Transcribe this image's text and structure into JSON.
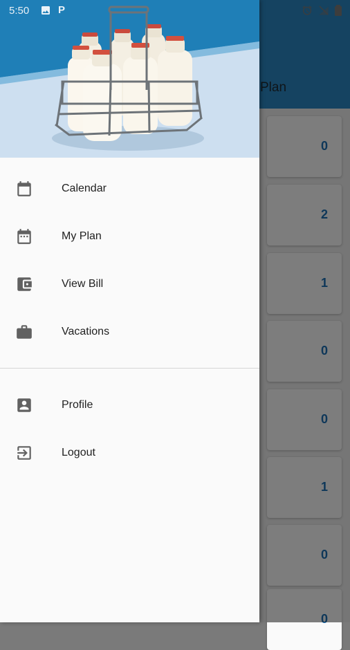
{
  "status_bar": {
    "time": "5:50",
    "left_icons": [
      "image-icon",
      "p-app-icon"
    ],
    "right_icons": [
      "alarm-icon",
      "wifi-off-icon",
      "signal-icon",
      "battery-icon"
    ]
  },
  "background_screen": {
    "title_fragment": "Plan",
    "counts": [
      "0",
      "2",
      "1",
      "0",
      "0",
      "1",
      "0",
      "0"
    ]
  },
  "drawer": {
    "header_image": "milk-bottles-in-crate",
    "items": [
      {
        "label": "Calendar",
        "icon": "calendar-icon"
      },
      {
        "label": "My Plan",
        "icon": "event-note-icon"
      },
      {
        "label": "View Bill",
        "icon": "wallet-icon"
      },
      {
        "label": "Vacations",
        "icon": "briefcase-icon"
      }
    ],
    "secondary_items": [
      {
        "label": "Profile",
        "icon": "account-box-icon"
      },
      {
        "label": "Logout",
        "icon": "logout-icon"
      }
    ]
  },
  "colors": {
    "app_bar": "#2a86c2",
    "count_text": "#1c6fb3",
    "drawer_bg": "#fafafa",
    "icon_gray": "#616161"
  }
}
